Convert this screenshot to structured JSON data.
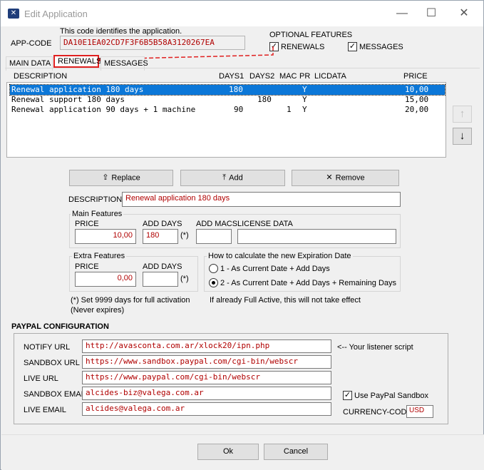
{
  "window": {
    "title": "Edit Application",
    "minimize": "—",
    "maximize": "☐",
    "close": "✕",
    "icon": "app-logo-icon"
  },
  "app_code": {
    "label": "APP-CODE",
    "hint": "This code identifies the application.",
    "value": "DA10E1EA02CD7F3F6B5B58A3120267EA"
  },
  "optional_features": {
    "title": "OPTIONAL FEATURES",
    "renewals": {
      "label": "RENEWALS",
      "checked": true
    },
    "messages": {
      "label": "MESSAGES",
      "checked": true
    }
  },
  "tabs": [
    {
      "label": "MAIN DATA",
      "active": false
    },
    {
      "label": "RENEWALS",
      "active": true
    },
    {
      "label": "MESSAGES",
      "active": false
    }
  ],
  "list": {
    "headers": [
      "DESCRIPTION",
      "DAYS1",
      "DAYS2",
      "MAC",
      "PR",
      "LICDATA",
      "PRICE"
    ],
    "rows": [
      {
        "description": "Renewal application 180 days",
        "days1": "180",
        "days2": "",
        "mac": "",
        "pr": "Y",
        "licdata": "",
        "price": "10,00",
        "selected": true
      },
      {
        "description": "Renewal support 180 days",
        "days1": "",
        "days2": "180",
        "mac": "",
        "pr": "Y",
        "licdata": "",
        "price": "15,00",
        "selected": false
      },
      {
        "description": "Renewal application 90 days + 1 machine",
        "days1": "90",
        "days2": "",
        "mac": "1",
        "pr": "Y",
        "licdata": "",
        "price": "20,00",
        "selected": false
      }
    ],
    "move_up_icon": "arrow-up-icon",
    "move_down_icon": "arrow-down-icon"
  },
  "actions": {
    "replace": "Replace",
    "add": "Add",
    "remove": "Remove"
  },
  "editor": {
    "description_label": "DESCRIPTION",
    "description_value": "Renewal application 180 days",
    "main_features": {
      "title": "Main Features",
      "price_label": "PRICE",
      "price_value": "10,00",
      "add_days_label": "ADD DAYS",
      "add_days_value": "180",
      "add_days_note": "(*)",
      "add_macs_label": "ADD MACS",
      "add_macs_value": "",
      "license_data_label": "LICENSE DATA",
      "license_data_value": ""
    },
    "extra_features": {
      "title": "Extra Features",
      "price_label": "PRICE",
      "price_value": "0,00",
      "add_days_label": "ADD DAYS",
      "add_days_value": "",
      "add_days_note": "(*)"
    },
    "expiration": {
      "title": "How to calculate the new Expiration Date",
      "option1": "1 - As Current Date + Add Days",
      "option2": "2 - As Current Date + Add Days + Remaining Days",
      "selected": 2
    },
    "note_line1": "(*) Set 9999 days for full activation",
    "note_line2": "(Never expires)",
    "full_active_note": "If already Full Active, this will not take effect"
  },
  "paypal": {
    "title": "PAYPAL CONFIGURATION",
    "notify_url_label": "NOTIFY URL",
    "notify_url_value": "http://avasconta.com.ar/xlock20/ipn.php",
    "listener_note": "<-- Your listener script",
    "sandbox_url_label": "SANDBOX URL",
    "sandbox_url_value": "https://www.sandbox.paypal.com/cgi-bin/webscr",
    "live_url_label": "LIVE URL",
    "live_url_value": "https://www.paypal.com/cgi-bin/webscr",
    "sandbox_email_label": "SANDBOX EMAIL",
    "sandbox_email_value": "alcides-biz@valega.com.ar",
    "live_email_label": "LIVE EMAIL",
    "live_email_value": "alcides@valega.com.ar",
    "use_sandbox_label": "Use PayPal Sandbox",
    "use_sandbox_checked": true,
    "currency_label": "CURRENCY-CODE",
    "currency_value": "USD"
  },
  "footer": {
    "ok": "Ok",
    "cancel": "Cancel"
  },
  "colors": {
    "selection": "#0b77d8",
    "annotation": "#e02020",
    "field_text": "#b00000"
  }
}
